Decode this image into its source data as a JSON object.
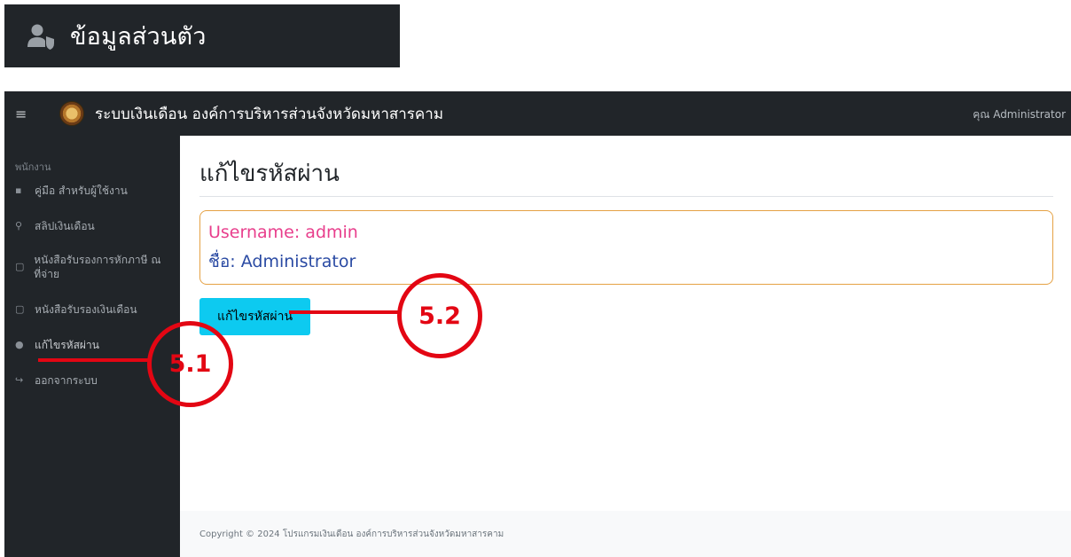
{
  "section_chip": {
    "title": "ข้อมูลส่วนตัว",
    "icon": "user-shield-icon"
  },
  "navbar": {
    "menu_icon": "≡",
    "title": "ระบบเงินเดือน องค์การบริหารส่วนจังหวัดมหาสารคาม",
    "user": "คุณ Administrator"
  },
  "sidebar": {
    "heading": "พนักงาน",
    "items": [
      {
        "label": "คู่มือ สำหรับผู้ใช้งาน",
        "icon": "file-icon"
      },
      {
        "label": "สลิปเงินเดือน",
        "icon": "search-icon"
      },
      {
        "label": "หนังสือรับรองการหักภาษี ณ ที่จ่าย",
        "icon": "document-icon"
      },
      {
        "label": "หนังสือรับรองเงินเดือน",
        "icon": "document-icon"
      },
      {
        "label": "แก้ไขรหัสผ่าน",
        "icon": "user-shield-icon"
      },
      {
        "label": "ออกจากระบบ",
        "icon": "sign-out-icon"
      }
    ]
  },
  "main": {
    "title": "แก้ไขรหัสผ่าน",
    "username_line": "Username: admin",
    "name_line": "ชื่อ: Administrator",
    "change_button": "แก้ไขรหัสผ่าน"
  },
  "footer": {
    "text": "Copyright © 2024 โปรแกรมเงินเดือน องค์การบริหารส่วนจังหวัดมหาสารคาม"
  },
  "annotations": {
    "a1": "5.1",
    "a2": "5.2",
    "color": "#e30613"
  }
}
